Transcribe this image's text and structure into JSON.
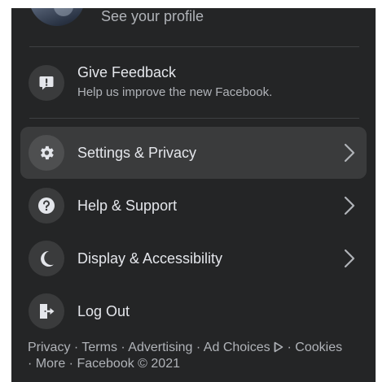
{
  "profile": {
    "subtitle": "See your profile"
  },
  "feedback": {
    "title": "Give Feedback",
    "subtitle": "Help us improve the new Facebook.",
    "icon": "exclamation-comment-icon"
  },
  "menu_items": [
    {
      "label": "Settings & Privacy",
      "icon": "gear-icon",
      "has_chevron": true,
      "highlighted": true
    },
    {
      "label": "Help & Support",
      "icon": "question-icon",
      "has_chevron": true,
      "highlighted": false
    },
    {
      "label": "Display & Accessibility",
      "icon": "moon-icon",
      "has_chevron": true,
      "highlighted": false
    },
    {
      "label": "Log Out",
      "icon": "logout-icon",
      "has_chevron": false,
      "highlighted": false
    }
  ],
  "footer": {
    "privacy": "Privacy",
    "terms": "Terms",
    "advertising": "Advertising",
    "ad_choices": "Ad Choices",
    "cookies": "Cookies",
    "more": "More",
    "copyright": "Facebook © 2021",
    "separator": " · "
  },
  "colors": {
    "background": "#242526",
    "highlight": "#3a3b3c",
    "primary_text": "#e4e6eb",
    "secondary_text": "#b0b3b8",
    "divider": "#3e4042"
  }
}
